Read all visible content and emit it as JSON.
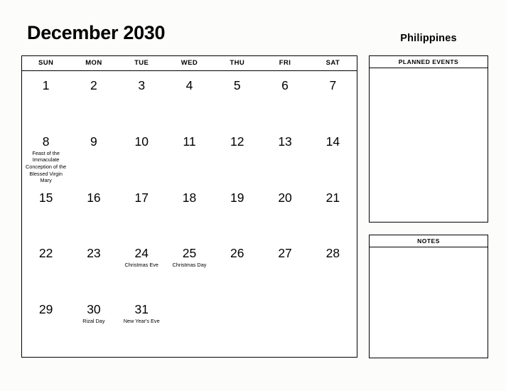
{
  "header": {
    "title": "December 2030",
    "country": "Philippines"
  },
  "calendar": {
    "weekdays": [
      "SUN",
      "MON",
      "TUE",
      "WED",
      "THU",
      "FRI",
      "SAT"
    ],
    "weeks": [
      [
        {
          "day": "1",
          "event": ""
        },
        {
          "day": "2",
          "event": ""
        },
        {
          "day": "3",
          "event": ""
        },
        {
          "day": "4",
          "event": ""
        },
        {
          "day": "5",
          "event": ""
        },
        {
          "day": "6",
          "event": ""
        },
        {
          "day": "7",
          "event": ""
        }
      ],
      [
        {
          "day": "8",
          "event": "Feast of the Immaculate Conception of the Blessed Virgin Mary"
        },
        {
          "day": "9",
          "event": ""
        },
        {
          "day": "10",
          "event": ""
        },
        {
          "day": "11",
          "event": ""
        },
        {
          "day": "12",
          "event": ""
        },
        {
          "day": "13",
          "event": ""
        },
        {
          "day": "14",
          "event": ""
        }
      ],
      [
        {
          "day": "15",
          "event": ""
        },
        {
          "day": "16",
          "event": ""
        },
        {
          "day": "17",
          "event": ""
        },
        {
          "day": "18",
          "event": ""
        },
        {
          "day": "19",
          "event": ""
        },
        {
          "day": "20",
          "event": ""
        },
        {
          "day": "21",
          "event": ""
        }
      ],
      [
        {
          "day": "22",
          "event": ""
        },
        {
          "day": "23",
          "event": ""
        },
        {
          "day": "24",
          "event": "Christmas Eve"
        },
        {
          "day": "25",
          "event": "Christmas Day"
        },
        {
          "day": "26",
          "event": ""
        },
        {
          "day": "27",
          "event": ""
        },
        {
          "day": "28",
          "event": ""
        }
      ],
      [
        {
          "day": "29",
          "event": ""
        },
        {
          "day": "30",
          "event": "Rizal Day"
        },
        {
          "day": "31",
          "event": "New Year's Eve"
        },
        {
          "day": "",
          "event": ""
        },
        {
          "day": "",
          "event": ""
        },
        {
          "day": "",
          "event": ""
        },
        {
          "day": "",
          "event": ""
        }
      ]
    ]
  },
  "panels": {
    "planned_events": {
      "title": "PLANNED EVENTS",
      "content": ""
    },
    "notes": {
      "title": "NOTES",
      "content": ""
    }
  }
}
